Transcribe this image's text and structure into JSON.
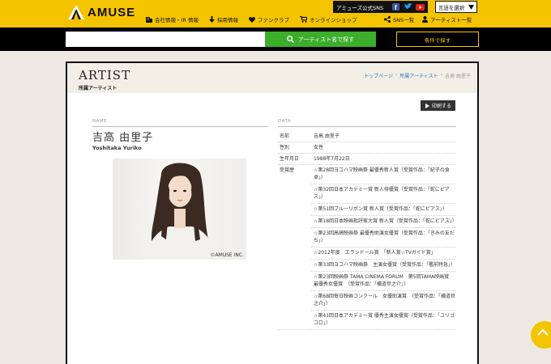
{
  "header": {
    "logo_text": "AMUSE",
    "sns_label": "アミューズ公式SNS",
    "sns_icons": [
      "facebook-icon",
      "twitter-icon",
      "youtube-icon"
    ],
    "language_label": "言語を選択",
    "nav": [
      {
        "label": "会社情報・IR 情報",
        "icon": "building-icon"
      },
      {
        "label": "採用情報",
        "icon": "download-icon"
      },
      {
        "label": "ファンクラブ",
        "icon": "heart-icon"
      },
      {
        "label": "オンラインショップ",
        "icon": "cart-icon"
      }
    ],
    "sub_nav": [
      {
        "label": "SNS一覧",
        "icon": "share-icon"
      },
      {
        "label": "アーティスト一覧",
        "icon": "person-icon"
      }
    ]
  },
  "search": {
    "placeholder": "",
    "button_label": "アーティスト名で探す",
    "condition_button_label": "条件で探す"
  },
  "page": {
    "title": "ARTIST",
    "subtitle": "所属アーティスト",
    "breadcrumb": [
      "トップページ",
      "所属アーティスト",
      "吉高 由里子"
    ],
    "print_label": "印刷する"
  },
  "artist": {
    "name_col_label": "NAME",
    "data_col_label": "DATA",
    "name": "吉高 由里子",
    "romaji": "Yoshitaka Yuriko",
    "photo_credit": "©AMUSE INC.",
    "fields": [
      {
        "key": "名前",
        "value": "吉高 由里子"
      },
      {
        "key": "性別",
        "value": "女性"
      },
      {
        "key": "生年月日",
        "value": "1988年7月22日"
      }
    ],
    "awards_key": "受賞歴",
    "awards": [
      "☆第28回ヨコハマ映画祭 最優秀新人賞（受賞作品：「紀子の食卓」）",
      "☆第32回日本アカデミー賞 新人俳優賞（受賞作品：「蛇にピアス」）",
      "☆第51回ブルーリボン賞 新人賞（受賞作品：「蛇にピアス」）",
      "☆第18回日本映画批評家大賞 新人賞（受賞作品：「蛇にピアス」）",
      "☆第23回高崎映画祭 最優秀助演女優賞（受賞作品：「きみの友だち」）",
      "☆2012年度　エランドール賞　「新人賞☆TVガイド賞」",
      "☆第33回ヨコハマ映画祭　主演女優賞（受賞作品：「檻前特急」）",
      "☆第23回映画祭 TAMA CINEMA FORUM　第5回TAMA映画賞　最優秀女優賞　（受賞作品：「横道世之介」）",
      "☆第68回毎日映画コンクール　女優助演賞　（受賞作品：「横道世之介」）",
      "☆第41回日本アカデミー賞 優秀主演女優賞（受賞作品：「ユリゴコロ」）"
    ]
  },
  "colors": {
    "brand_yellow": "#f5c400",
    "search_green": "#3cae2c",
    "link_blue": "#2c6fb3"
  }
}
